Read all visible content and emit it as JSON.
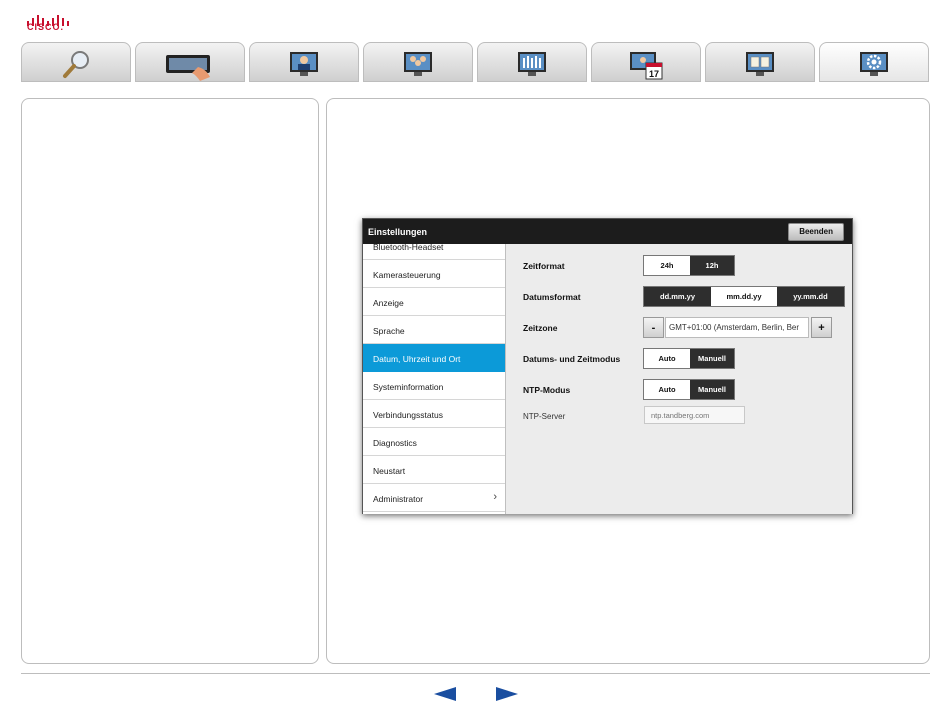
{
  "brand": {
    "logo_text": "CISCO."
  },
  "tabs": [
    {
      "icon": "magnifier-icon"
    },
    {
      "icon": "touch-panel-icon"
    },
    {
      "icon": "video-call-icon"
    },
    {
      "icon": "multipoint-call-icon"
    },
    {
      "icon": "camera-control-icon"
    },
    {
      "icon": "calendar-icon",
      "badge": "17"
    },
    {
      "icon": "manual-book-icon"
    },
    {
      "icon": "settings-gear-icon"
    }
  ],
  "window": {
    "title": "Einstellungen",
    "close_label": "Beenden"
  },
  "menu": {
    "items": [
      {
        "label": "Bluetooth-Headset"
      },
      {
        "label": "Kamerasteuerung"
      },
      {
        "label": "Anzeige"
      },
      {
        "label": "Sprache"
      },
      {
        "label": "Datum, Uhrzeit und Ort"
      },
      {
        "label": "Systeminformation"
      },
      {
        "label": "Verbindungsstatus"
      },
      {
        "label": "Diagnostics"
      },
      {
        "label": "Neustart"
      },
      {
        "label": "Administrator"
      }
    ],
    "active_index": 4
  },
  "settings": {
    "zeitformat": {
      "label": "Zeitformat",
      "options": [
        "24h",
        "12h"
      ],
      "selected": "24h"
    },
    "datumsformat": {
      "label": "Datumsformat",
      "options": [
        "dd.mm.yy",
        "mm.dd.yy",
        "yy.mm.dd"
      ],
      "selected": "mm.dd.yy"
    },
    "zeitzone": {
      "label": "Zeitzone",
      "minus": "-",
      "plus": "+",
      "value": "GMT+01:00 (Amsterdam, Berlin, Ber"
    },
    "datums_zeitmodus": {
      "label": "Datums- und Zeitmodus",
      "options": [
        "Auto",
        "Manuell"
      ],
      "selected": "Auto"
    },
    "ntp_modus": {
      "label": "NTP-Modus",
      "options": [
        "Auto",
        "Manuell"
      ],
      "selected": "Auto"
    },
    "ntp_server": {
      "label": "NTP-Server",
      "placeholder": "ntp.tandberg.com"
    }
  },
  "colors": {
    "accent": "#0c9ad8",
    "nav_arrow": "#1a4ea0",
    "brand_red": "#c8102e"
  }
}
